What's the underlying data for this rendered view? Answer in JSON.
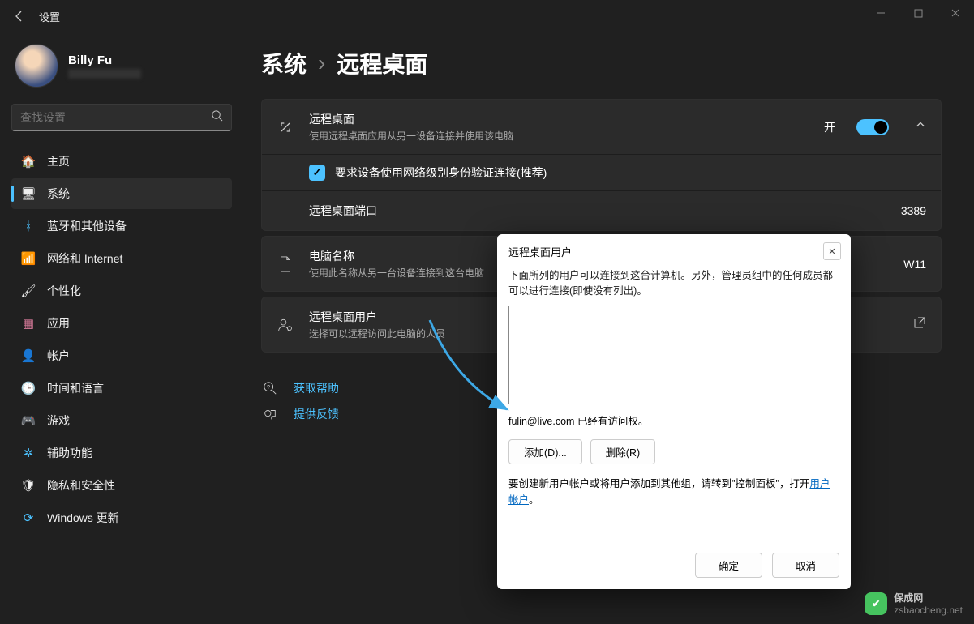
{
  "window": {
    "title": "设置"
  },
  "user": {
    "name": "Billy Fu"
  },
  "search": {
    "placeholder": "查找设置"
  },
  "nav": [
    {
      "icon": "🏠",
      "label": "主页"
    },
    {
      "icon": "🖥",
      "label": "系统",
      "active": true
    },
    {
      "icon": "ᚼ",
      "label": "蓝牙和其他设备",
      "iconColor": "#4cc2ff"
    },
    {
      "icon": "📶",
      "label": "网络和 Internet",
      "iconColor": "#4cc2ff"
    },
    {
      "icon": "🖌",
      "label": "个性化"
    },
    {
      "icon": "▦",
      "label": "应用",
      "iconColor": "#d87a9a"
    },
    {
      "icon": "👤",
      "label": "帐户",
      "iconColor": "#e89b5a"
    },
    {
      "icon": "🕒",
      "label": "时间和语言",
      "iconColor": "#4cc2ff"
    },
    {
      "icon": "🎮",
      "label": "游戏"
    },
    {
      "icon": "✲",
      "label": "辅助功能",
      "iconColor": "#4cc2ff"
    },
    {
      "icon": "🛡",
      "label": "隐私和安全性"
    },
    {
      "icon": "⟳",
      "label": "Windows 更新",
      "iconColor": "#4cc2ff"
    }
  ],
  "breadcrumb": {
    "root": "系统",
    "leaf": "远程桌面"
  },
  "rd": {
    "title": "远程桌面",
    "sub": "使用远程桌面应用从另一设备连接并使用该电脑",
    "toggle_label": "开",
    "nla": "要求设备使用网络级别身份验证连接(推荐)",
    "port_label": "远程桌面端口",
    "port_value": "3389"
  },
  "pc": {
    "title": "电脑名称",
    "sub": "使用此名称从另一台设备连接到这台电脑",
    "value": "W11"
  },
  "users": {
    "title": "远程桌面用户",
    "sub": "选择可以远程访问此电脑的人员"
  },
  "help": {
    "get": "获取帮助",
    "feedback": "提供反馈"
  },
  "dialog": {
    "title": "远程桌面用户",
    "desc": "下面所列的用户可以连接到这台计算机。另外，管理员组中的任何成员都可以进行连接(即使没有列出)。",
    "access_line": "fulin@live.com 已经有访问权。",
    "add": "添加(D)...",
    "remove": "删除(R)",
    "note_prefix": "要创建新用户帐户或将用户添加到其他组，请转到\"控制面板\"，打开",
    "note_link": "用户帐户",
    "note_suffix": "。",
    "ok": "确定",
    "cancel": "取消"
  },
  "watermark": {
    "name": "保成网",
    "url": "zsbaocheng.net"
  }
}
